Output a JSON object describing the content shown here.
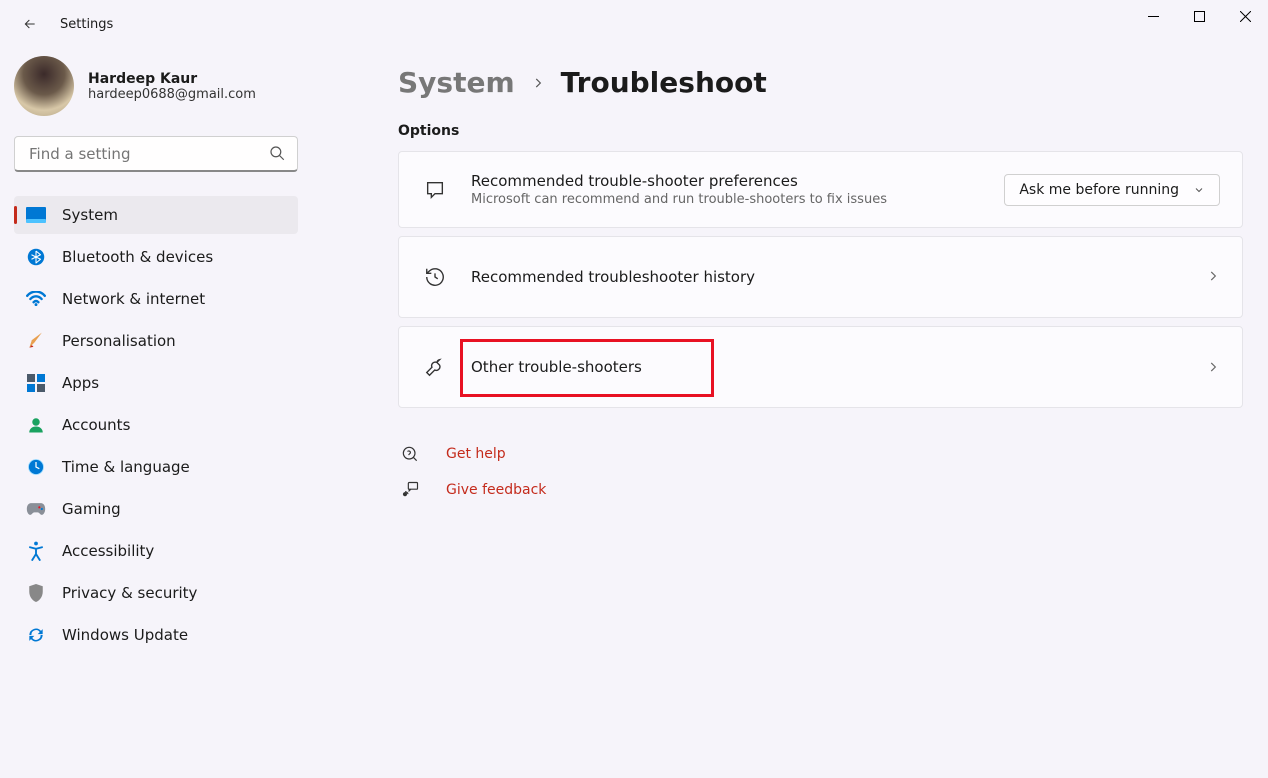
{
  "app": {
    "title": "Settings"
  },
  "user": {
    "name": "Hardeep Kaur",
    "email": "hardeep0688@gmail.com"
  },
  "search": {
    "placeholder": "Find a setting"
  },
  "sidebar": {
    "items": [
      {
        "label": "System",
        "active": true
      },
      {
        "label": "Bluetooth & devices"
      },
      {
        "label": "Network & internet"
      },
      {
        "label": "Personalisation"
      },
      {
        "label": "Apps"
      },
      {
        "label": "Accounts"
      },
      {
        "label": "Time & language"
      },
      {
        "label": "Gaming"
      },
      {
        "label": "Accessibility"
      },
      {
        "label": "Privacy & security"
      },
      {
        "label": "Windows Update"
      }
    ]
  },
  "breadcrumb": {
    "parent": "System",
    "current": "Troubleshoot"
  },
  "sections": {
    "options": "Options"
  },
  "cards": {
    "recommended": {
      "title": "Recommended trouble-shooter preferences",
      "sub": "Microsoft can recommend and run trouble-shooters to fix issues",
      "dropdown_value": "Ask me before running"
    },
    "history": {
      "title": "Recommended troubleshooter history"
    },
    "other": {
      "title": "Other trouble-shooters"
    }
  },
  "help": {
    "get_help": "Get help",
    "give_feedback": "Give feedback"
  }
}
